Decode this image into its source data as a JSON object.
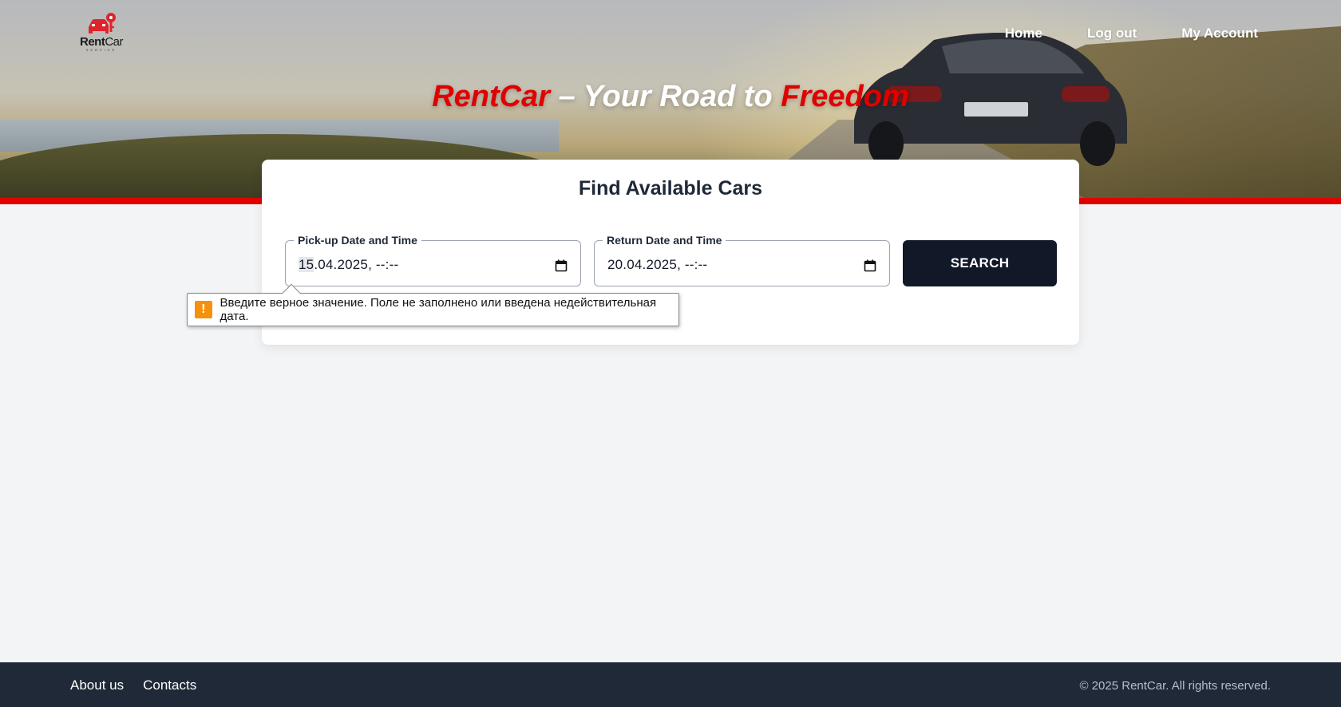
{
  "brand": {
    "logo_text_bold": "Rent",
    "logo_text_light": "Car",
    "logo_subtext": "SERVICE",
    "accent_color": "#e00000",
    "dark_color": "#111827"
  },
  "nav": {
    "items": [
      {
        "label": "Home"
      },
      {
        "label": "Log out"
      },
      {
        "label": "My Account"
      }
    ]
  },
  "hero": {
    "tagline_part1": "RentCar",
    "tagline_part2": " – Your Road to ",
    "tagline_part3": "Freedom"
  },
  "search": {
    "title": "Find Available Cars",
    "pickup": {
      "label": "Pick-up Date and Time",
      "value_day": "15",
      "value_rest": ".04.2025, --:--"
    },
    "return": {
      "label": "Return Date and Time",
      "value": "20.04.2025, --:--"
    },
    "button_label": "SEARCH"
  },
  "validation": {
    "icon": "warning-icon",
    "icon_glyph": "!",
    "message": "Введите верное значение. Поле не заполнено или введена недействительная дата."
  },
  "footer": {
    "links": [
      {
        "label": "About us"
      },
      {
        "label": "Contacts"
      }
    ],
    "copyright": "© 2025 RentCar. All rights reserved."
  }
}
